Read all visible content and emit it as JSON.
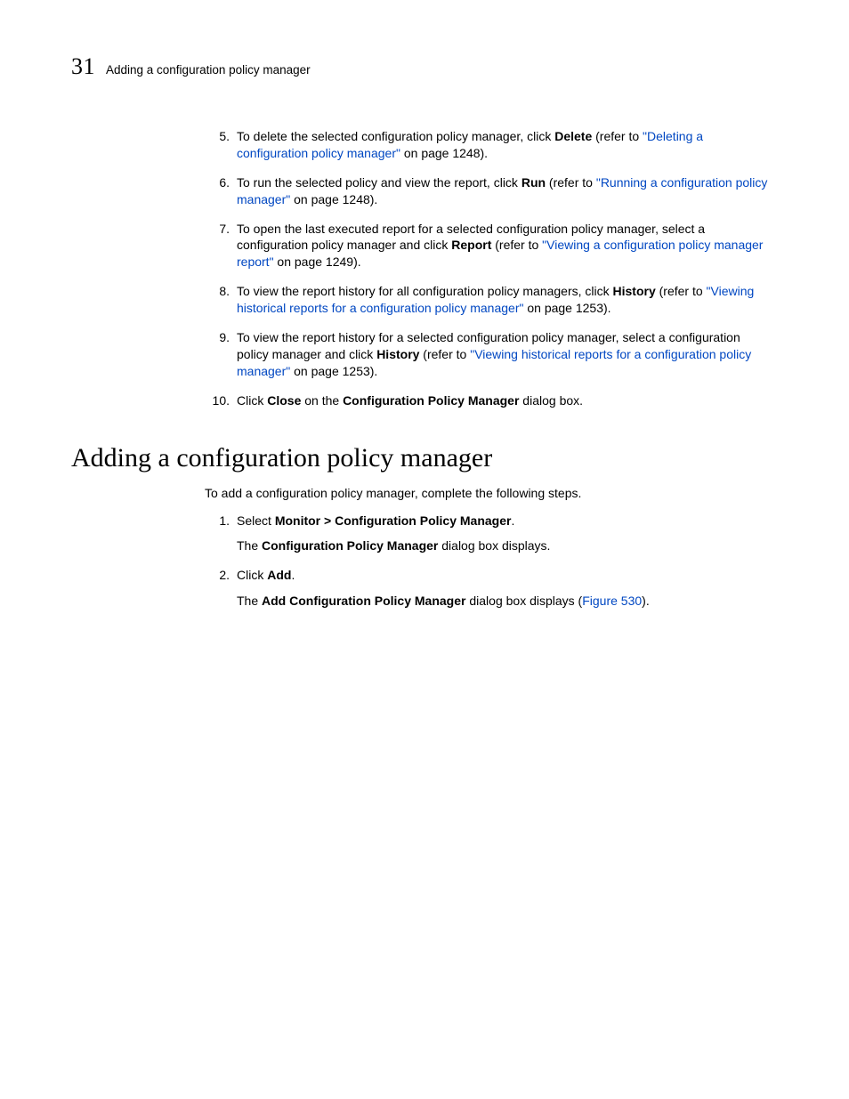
{
  "header": {
    "chapter_number": "31",
    "running_title": "Adding a configuration policy manager"
  },
  "steps_top": [
    {
      "num": "5.",
      "pre": "To delete the selected configuration policy manager, click ",
      "bold1": "Delete",
      "mid1": " (refer to ",
      "link": "\"Deleting a configuration policy manager\"",
      "post": " on page 1248)."
    },
    {
      "num": "6.",
      "pre": "To run the selected policy and view the report, click ",
      "bold1": "Run",
      "mid1": " (refer to ",
      "link": "\"Running a configuration policy manager\"",
      "post": " on page 1248)."
    },
    {
      "num": "7.",
      "pre": "To open the last executed report for a selected configuration policy manager, select a configuration policy manager and click ",
      "bold1": "Report",
      "mid1": " (refer to ",
      "link": "\"Viewing a configuration policy manager report\"",
      "post": " on page 1249)."
    },
    {
      "num": "8.",
      "pre": "To view the report history for all configuration policy managers, click ",
      "bold1": "History",
      "mid1": " (refer to ",
      "link": "\"Viewing historical reports for a configuration policy manager\"",
      "post": " on page 1253)."
    },
    {
      "num": "9.",
      "pre": "To view the report history for a selected configuration policy manager, select a configuration policy manager and click ",
      "bold1": "History",
      "mid1": " (refer to ",
      "link": "\"Viewing historical reports for a configuration policy manager\"",
      "post": " on page 1253)."
    }
  ],
  "step10": {
    "num": "10.",
    "t1": "Click ",
    "b1": "Close",
    "t2": " on the ",
    "b2": "Configuration Policy Manager",
    "t3": " dialog box."
  },
  "section_title": "Adding a configuration policy manager",
  "intro": "To add a configuration policy manager, complete the following steps.",
  "substeps": {
    "s1": {
      "num": "1.",
      "t1": "Select ",
      "b1": "Monitor > Configuration Policy Manager",
      "t2": ".",
      "p_t1": "The ",
      "p_b1": "Configuration Policy Manager",
      "p_t2": " dialog box displays."
    },
    "s2": {
      "num": "2.",
      "t1": "Click ",
      "b1": "Add",
      "t2": ".",
      "p_t1": "The ",
      "p_b1": "Add Configuration Policy Manager",
      "p_t2": " dialog box displays (",
      "p_link": "Figure 530",
      "p_t3": ")."
    }
  }
}
